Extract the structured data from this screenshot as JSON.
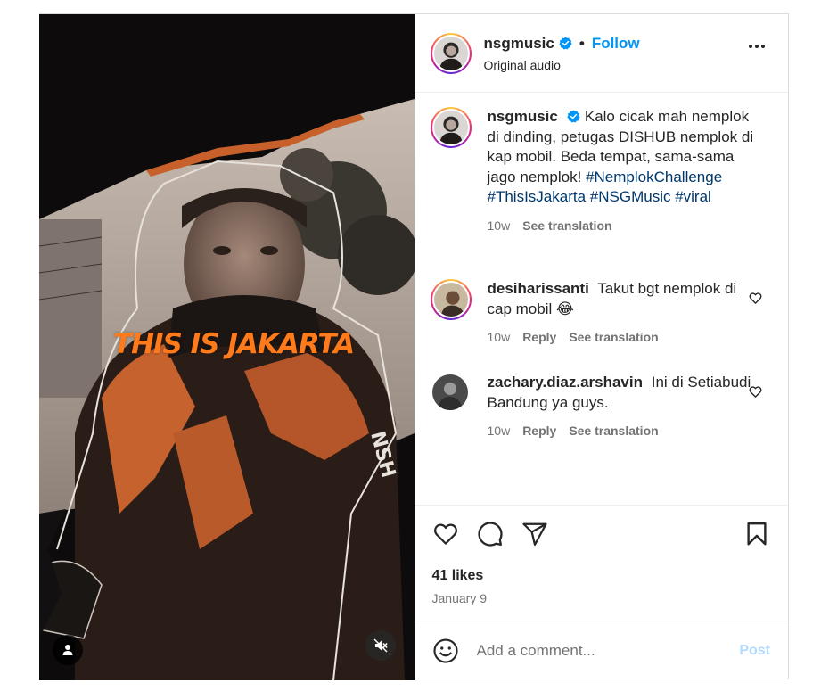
{
  "media": {
    "overlay_text": "THIS IS JAKARTA",
    "overlay_color": "#ff7a1a",
    "user_tag_icon": "person-icon",
    "mute_icon": "speaker-muted-icon"
  },
  "header": {
    "username": "nsgmusic",
    "verified_icon": "verified-badge-icon",
    "separator": "•",
    "follow_label": "Follow",
    "subtitle": "Original audio",
    "more_icon": "more-options-icon"
  },
  "caption": {
    "username": "nsgmusic",
    "text": "Kalo cicak mah nemplok di dinding, petugas DISHUB nemplok di kap mobil. Beda tempat, sama-sama jago nemplok!",
    "hashtags": [
      "#NemplokChallenge",
      "#ThisIsJakarta",
      "#NSGMusic",
      "#viral"
    ],
    "time": "10w",
    "see_translation": "See translation"
  },
  "comments": [
    {
      "username": "desiharissanti",
      "text": "Takut bgt nemplok di cap mobil",
      "emoji": "😂",
      "time": "10w",
      "reply": "Reply",
      "see_translation": "See translation"
    },
    {
      "username": "zachary.diaz.arshavin",
      "text": "Ini di Setiabudi Bandung ya guys.",
      "time": "10w",
      "reply": "Reply",
      "see_translation": "See translation"
    }
  ],
  "actions": {
    "like_icon": "heart-icon",
    "comment_icon": "comment-icon",
    "share_icon": "share-icon",
    "save_icon": "bookmark-icon",
    "likes": "41 likes",
    "date": "January 9"
  },
  "add_comment": {
    "emoji_icon": "emoji-icon",
    "placeholder": "Add a comment...",
    "post_label": "Post"
  },
  "colors": {
    "link_blue": "#0095f6",
    "hashtag": "#00376b",
    "muted_text": "#737373",
    "post_disabled": "#b3dbff"
  }
}
